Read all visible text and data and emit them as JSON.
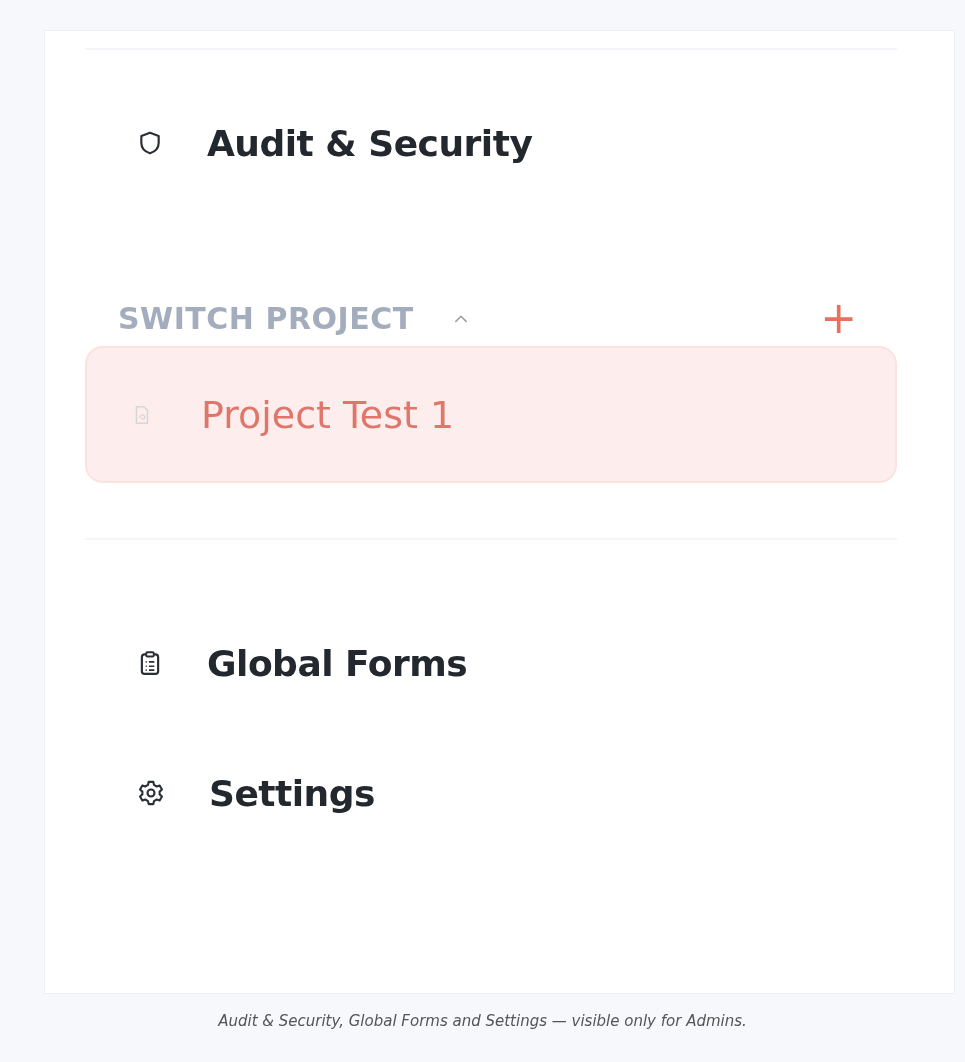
{
  "sidebar": {
    "top_items": [
      {
        "label": "Audit & Security"
      }
    ],
    "project_section": {
      "title": "SWITCH PROJECT",
      "expanded": true,
      "add_button": "+",
      "projects": [
        {
          "label": "Project Test 1",
          "selected": true
        }
      ]
    },
    "bottom_items": [
      {
        "label": "Global Forms"
      },
      {
        "label": "Settings"
      }
    ]
  },
  "caption": "Audit & Security, Global Forms and Settings — visible only for Admins."
}
